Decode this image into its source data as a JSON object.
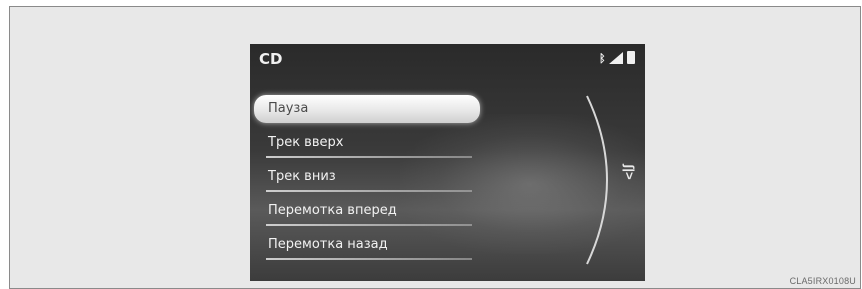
{
  "screen": {
    "title": "CD",
    "status_icons": [
      "bluetooth-icon",
      "signal-icon",
      "battery-icon"
    ],
    "side_icon_label": "ʃ|>",
    "menu": [
      {
        "label": "Пауза",
        "selected": true
      },
      {
        "label": "Трек вверх",
        "selected": false
      },
      {
        "label": "Трек вниз",
        "selected": false
      },
      {
        "label": "Перемотка вперед",
        "selected": false
      },
      {
        "label": "Перемотка назад",
        "selected": false
      }
    ]
  },
  "caption": "CLA5IRX0108U",
  "colors": {
    "screen_bg": "#333333",
    "selected_bg": "#ffffff",
    "text": "#f2f2f2",
    "frame_bg": "#e8e8e8"
  }
}
